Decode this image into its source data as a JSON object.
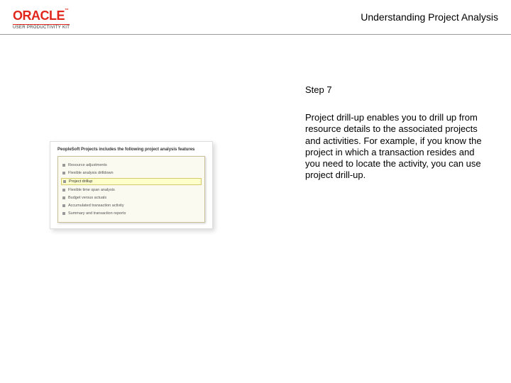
{
  "header": {
    "logo_text": "ORACLE",
    "logo_sub": "USER PRODUCTIVITY KIT",
    "title": "Understanding Project Analysis"
  },
  "slide": {
    "heading": "PeopleSoft Projects includes the following project analysis features",
    "items": [
      {
        "text": "Resource adjustments",
        "highlight": false
      },
      {
        "text": "Flexible analysis drilldown",
        "highlight": false
      },
      {
        "text": "Project drillup",
        "highlight": true
      },
      {
        "text": "Flexible time span analysis",
        "highlight": false
      },
      {
        "text": "Budget versus actuals",
        "highlight": false
      },
      {
        "text": "Accumulated transaction activity",
        "highlight": false
      },
      {
        "text": "Summary and transaction reports",
        "highlight": false
      }
    ]
  },
  "step": {
    "label": "Step 7",
    "body": "Project drill-up enables you to drill up from resource details to the associated projects and activities. For example, if you know the project in which a transaction resides and you need to locate the activity, you can use project drill-up."
  }
}
